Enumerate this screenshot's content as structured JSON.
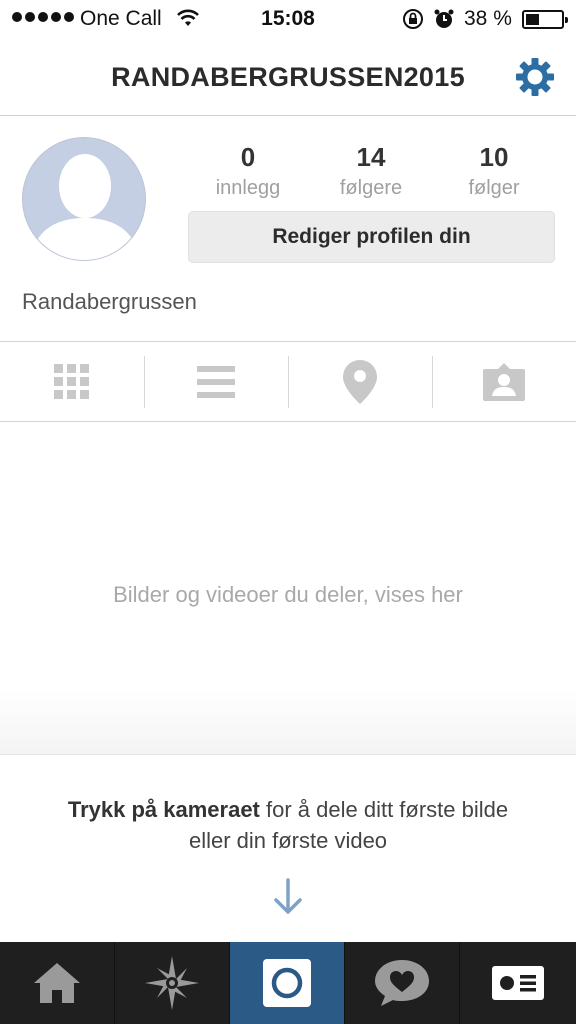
{
  "status_bar": {
    "carrier": "One Call",
    "time": "15:08",
    "battery_percent": "38 %",
    "battery_level": 0.38
  },
  "header": {
    "title": "RANDABERGRUSSEN2015",
    "settings_icon": "gear-icon",
    "accent_color": "#2c6ea3"
  },
  "profile": {
    "name": "Randabergrussen",
    "stats": [
      {
        "value": "0",
        "label": "innlegg"
      },
      {
        "value": "14",
        "label": "følgere"
      },
      {
        "value": "10",
        "label": "følger"
      }
    ],
    "edit_label": "Rediger profilen din"
  },
  "tabs": [
    {
      "icon": "grid-icon"
    },
    {
      "icon": "list-icon"
    },
    {
      "icon": "location-pin-icon"
    },
    {
      "icon": "tagged-photos-icon"
    }
  ],
  "empty_state": {
    "message": "Bilder og videoer du deler, vises her",
    "hint_bold": "Trykk på kameraet",
    "hint_rest_1": " for å dele ditt første bilde",
    "hint_rest_2": "eller din første video"
  },
  "bottom_nav": [
    {
      "icon": "home-icon"
    },
    {
      "icon": "explore-icon"
    },
    {
      "icon": "camera-icon",
      "active_color": "#2c5a86"
    },
    {
      "icon": "activity-heart-icon"
    },
    {
      "icon": "profile-card-icon"
    }
  ]
}
